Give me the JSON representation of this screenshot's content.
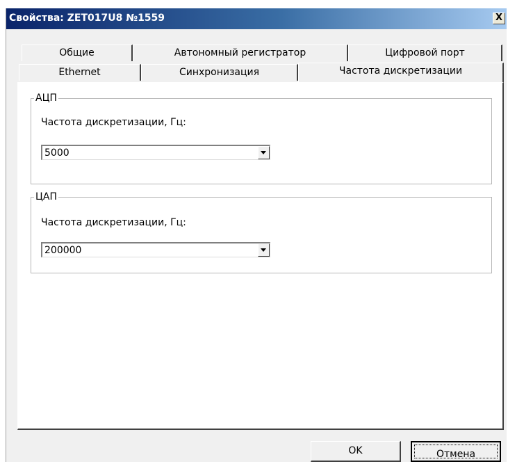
{
  "window": {
    "title": "Свойства: ZET017U8 №1559",
    "close_label": "X"
  },
  "tabs_back": [
    {
      "label": "Общие"
    },
    {
      "label": "Автономный регистратор"
    },
    {
      "label": "Цифровой порт"
    }
  ],
  "tabs_front": [
    {
      "label": "Ethernet"
    },
    {
      "label": "Синхронизация"
    },
    {
      "label": "Частота дискретизации",
      "active": true
    }
  ],
  "adc_group": {
    "label": "АЦП",
    "field_label": "Частота дискретизации, Гц:",
    "value": "5000"
  },
  "dac_group": {
    "label": "ЦАП",
    "field_label": "Частота дискретизации, Гц:",
    "value": "200000"
  },
  "buttons": {
    "ok": "OK",
    "cancel": "Отмена"
  }
}
